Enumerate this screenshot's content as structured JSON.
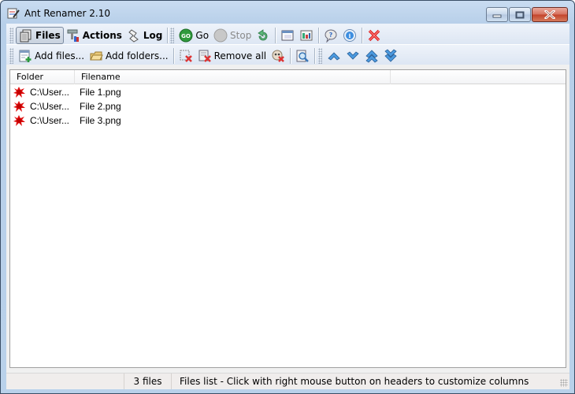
{
  "window": {
    "title": "Ant Renamer 2.10",
    "controls": {
      "minimize": "minimize",
      "maximize": "maximize",
      "close": "close"
    }
  },
  "toolbar_main": {
    "files_label": "Files",
    "actions_label": "Actions",
    "log_label": "Log",
    "go_label": "Go",
    "stop_label": "Stop",
    "icons": [
      "files-icon",
      "actions-icon",
      "log-icon",
      "go-icon",
      "stop-icon",
      "undo-icon",
      "window-icon",
      "settings-icon",
      "help-icon",
      "info-icon",
      "exit-icon"
    ]
  },
  "toolbar_files": {
    "add_files_label": "Add files...",
    "add_folders_label": "Add folders...",
    "remove_all_label": "Remove all",
    "icons": [
      "add-files-icon",
      "add-folders-icon",
      "remove-selected-icon",
      "remove-all-icon",
      "remove-dead-icon",
      "preview-icon",
      "move-up-icon",
      "move-down-icon",
      "move-top-icon",
      "move-bottom-icon"
    ]
  },
  "file_list": {
    "columns": [
      "Folder",
      "Filename",
      ""
    ],
    "rows": [
      {
        "folder": "C:\\User...",
        "filename": "File 1.png",
        "status": "error"
      },
      {
        "folder": "C:\\User...",
        "filename": "File 2.png",
        "status": "error"
      },
      {
        "folder": "C:\\User...",
        "filename": "File 3.png",
        "status": "error"
      }
    ]
  },
  "status_bar": {
    "panel1": "",
    "file_count": "3 files",
    "hint": "Files list - Click with right mouse button on headers to customize columns"
  },
  "colors": {
    "frame": "#b9d1ea",
    "toolbar": "#dde6f3",
    "error_icon": "#e01010",
    "arrow_blue": "#3a8fd6",
    "close_red": "#c3432a"
  }
}
